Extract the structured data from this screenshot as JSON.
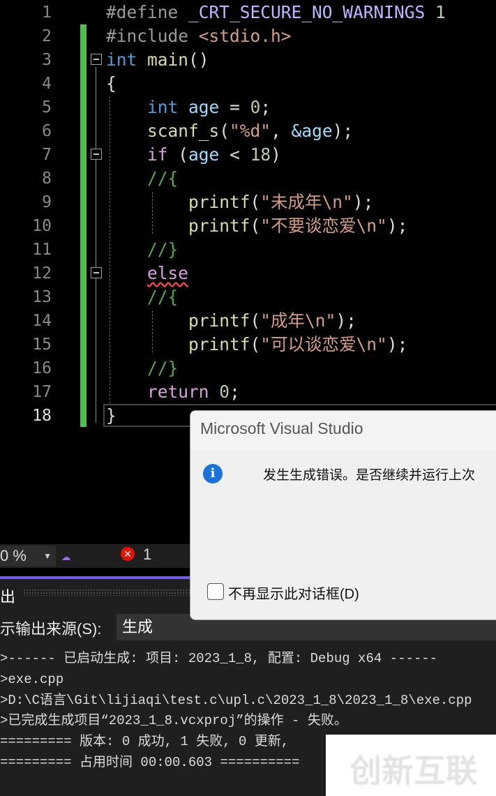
{
  "editor": {
    "current_line": 18,
    "lines": [
      [
        [
          "#define ",
          "pp"
        ],
        [
          "_CRT_SECURE_NO_WARNINGS",
          "mac"
        ],
        [
          " 1",
          "num"
        ]
      ],
      [
        [
          "#include ",
          "pp"
        ],
        [
          "<stdio.h>",
          "str"
        ]
      ],
      [
        [
          "int",
          "kw"
        ],
        [
          " ",
          "pl"
        ],
        [
          "main",
          "fn"
        ],
        [
          "()",
          "pl"
        ]
      ],
      [
        [
          "{",
          "pl"
        ]
      ],
      [
        [
          "    ",
          "pl"
        ],
        [
          "int",
          "kw"
        ],
        [
          " ",
          "pl"
        ],
        [
          "age",
          "var"
        ],
        [
          " = ",
          "pl"
        ],
        [
          "0",
          "num"
        ],
        [
          ";",
          "pl"
        ]
      ],
      [
        [
          "    ",
          "pl"
        ],
        [
          "scanf_s",
          "fn"
        ],
        [
          "(",
          "pl"
        ],
        [
          "\"%d\"",
          "str"
        ],
        [
          ", ",
          "pl"
        ],
        [
          "&age",
          "var"
        ],
        [
          ");",
          "pl"
        ]
      ],
      [
        [
          "    ",
          "pl"
        ],
        [
          "if",
          "ctl"
        ],
        [
          " (",
          "pl"
        ],
        [
          "age",
          "var"
        ],
        [
          " < ",
          "pl"
        ],
        [
          "18",
          "num"
        ],
        [
          ")",
          "pl"
        ]
      ],
      [
        [
          "    ",
          "pl"
        ],
        [
          "//{",
          "cm"
        ]
      ],
      [
        [
          "        ",
          "pl"
        ],
        [
          "printf",
          "fn"
        ],
        [
          "(",
          "pl"
        ],
        [
          "\"未成年\\n\"",
          "str"
        ],
        [
          ");",
          "pl"
        ]
      ],
      [
        [
          "        ",
          "pl"
        ],
        [
          "printf",
          "fn"
        ],
        [
          "(",
          "pl"
        ],
        [
          "\"不要谈恋爱\\n\"",
          "str"
        ],
        [
          ");",
          "pl"
        ]
      ],
      [
        [
          "    ",
          "pl"
        ],
        [
          "//}",
          "cm"
        ]
      ],
      [
        [
          "    ",
          "pl"
        ],
        [
          "else",
          "ctl squig"
        ]
      ],
      [
        [
          "    ",
          "pl"
        ],
        [
          "//{",
          "cm"
        ]
      ],
      [
        [
          "        ",
          "pl"
        ],
        [
          "printf",
          "fn"
        ],
        [
          "(",
          "pl"
        ],
        [
          "\"成年\\n\"",
          "str"
        ],
        [
          ");",
          "pl"
        ]
      ],
      [
        [
          "        ",
          "pl"
        ],
        [
          "printf",
          "fn"
        ],
        [
          "(",
          "pl"
        ],
        [
          "\"可以谈恋爱\\n\"",
          "str"
        ],
        [
          ");",
          "pl"
        ]
      ],
      [
        [
          "    ",
          "pl"
        ],
        [
          "//}",
          "cm"
        ]
      ],
      [
        [
          "    ",
          "pl"
        ],
        [
          "return",
          "ctl"
        ],
        [
          " ",
          "pl"
        ],
        [
          "0",
          "num"
        ],
        [
          ";",
          "pl"
        ]
      ],
      [
        [
          "}",
          "pl"
        ]
      ]
    ]
  },
  "toolbar": {
    "zoom": "0 %",
    "error_count": "1"
  },
  "output": {
    "title": "出",
    "source_label": "示输出来源(S):",
    "source_value": "生成",
    "lines": [
      ">------ 已启动生成: 项目: 2023_1_8, 配置: Debug x64 ------",
      ">exe.cpp",
      ">D:\\C语言\\Git\\lijiaqi\\test.c\\upl.c\\2023_1_8\\2023_1_8\\exe.cpp",
      ">已完成生成项目“2023_1_8.vcxproj”的操作 - 失败。",
      "========= 版本: 0 成功, 1 失败, 0 更新, ",
      "========= 占用时间 00:00.603 =========="
    ]
  },
  "dialog": {
    "title": "Microsoft Visual Studio",
    "message": "发生生成错误。是否继续并运行上次",
    "checkbox_label": "不再显示此对话框(D)"
  },
  "watermark": "创新互联"
}
